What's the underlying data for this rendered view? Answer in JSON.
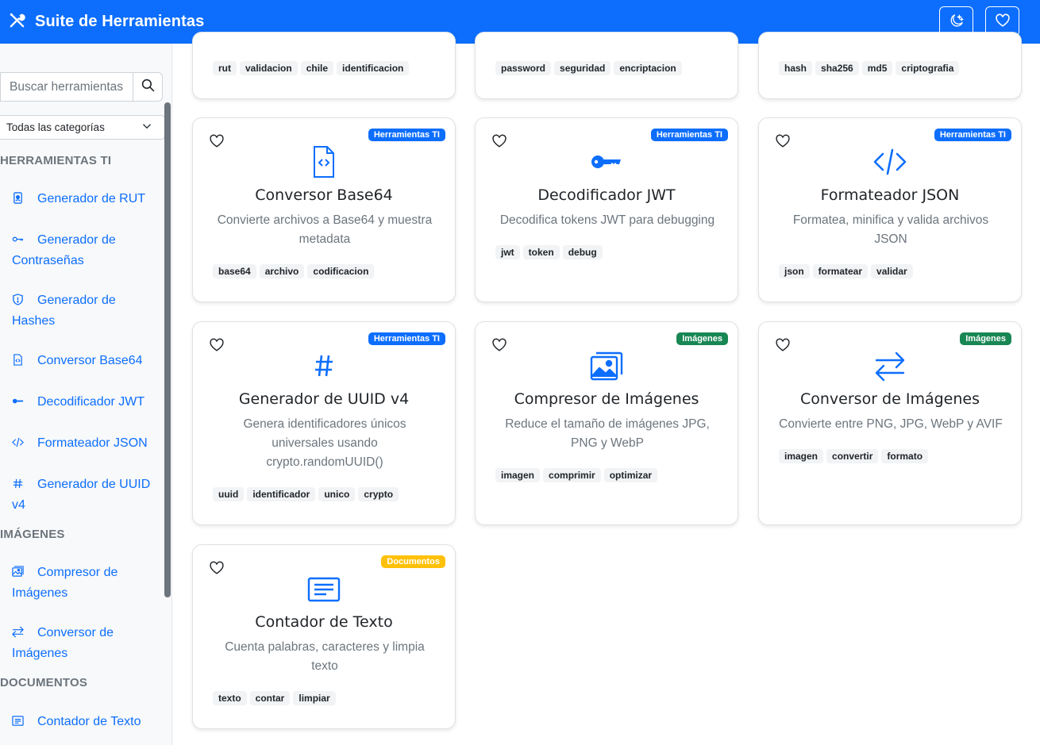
{
  "app": {
    "title": "Suite de Herramientas",
    "brand_icon": "tools-icon"
  },
  "header_buttons": [
    {
      "name": "theme-toggle",
      "icon": "moon-stars-icon"
    },
    {
      "name": "favorites",
      "icon": "heart-icon"
    }
  ],
  "colors": {
    "primary": "#0d6efd",
    "success": "#198754",
    "warning": "#ffc107",
    "muted": "#6c757d"
  },
  "sidebar": {
    "search_placeholder": "Buscar herramientas",
    "category_selected": "Todas las categorías",
    "sections": [
      {
        "title": "HERRAMIENTAS TI",
        "items": [
          "Generador de RUT",
          "Generador de Contraseñas",
          "Generador de Hashes",
          "Conversor Base64",
          "Decodificador JWT",
          "Formateador JSON",
          "Generador de UUID v4"
        ]
      },
      {
        "title": "IMÁGENES",
        "items": [
          "Compresor de Imágenes",
          "Conversor de Imágenes"
        ]
      },
      {
        "title": "DOCUMENTOS",
        "items": [
          "Contador de Texto"
        ]
      }
    ]
  },
  "top_partial_cards": [
    {
      "tags": [
        "rut",
        "validacion",
        "chile",
        "identificacion"
      ]
    },
    {
      "tags": [
        "password",
        "seguridad",
        "encriptacion"
      ]
    },
    {
      "tags": [
        "hash",
        "sha256",
        "md5",
        "criptografia"
      ]
    }
  ],
  "cards": [
    {
      "category": "Herramientas TI",
      "icon": "file-code-icon",
      "title": "Conversor Base64",
      "description": "Convierte archivos a Base64 y muestra metadata",
      "tags": [
        "base64",
        "archivo",
        "codificacion"
      ]
    },
    {
      "category": "Herramientas TI",
      "icon": "key-icon",
      "title": "Decodificador JWT",
      "description": "Decodifica tokens JWT para debugging",
      "tags": [
        "jwt",
        "token",
        "debug"
      ]
    },
    {
      "category": "Herramientas TI",
      "icon": "code-slash-icon",
      "title": "Formateador JSON",
      "description": "Formatea, minifica y valida archivos JSON",
      "tags": [
        "json",
        "formatear",
        "validar"
      ]
    },
    {
      "category": "Herramientas TI",
      "icon": "hash-icon",
      "title": "Generador de UUID v4",
      "description": "Genera identificadores únicos universales usando crypto.randomUUID()",
      "tags": [
        "uuid",
        "identificador",
        "unico",
        "crypto"
      ]
    },
    {
      "category": "Imágenes",
      "icon": "images-icon",
      "title": "Compresor de Imágenes",
      "description": "Reduce el tamaño de imágenes JPG, PNG y WebP",
      "tags": [
        "imagen",
        "comprimir",
        "optimizar"
      ]
    },
    {
      "category": "Imágenes",
      "icon": "arrow-left-right-icon",
      "title": "Conversor de Imágenes",
      "description": "Convierte entre PNG, JPG, WebP y AVIF",
      "tags": [
        "imagen",
        "convertir",
        "formato"
      ]
    },
    {
      "category": "Documentos",
      "icon": "text-lines-icon",
      "title": "Contador de Texto",
      "description": "Cuenta palabras, caracteres y limpia texto",
      "tags": [
        "texto",
        "contar",
        "limpiar"
      ]
    }
  ]
}
